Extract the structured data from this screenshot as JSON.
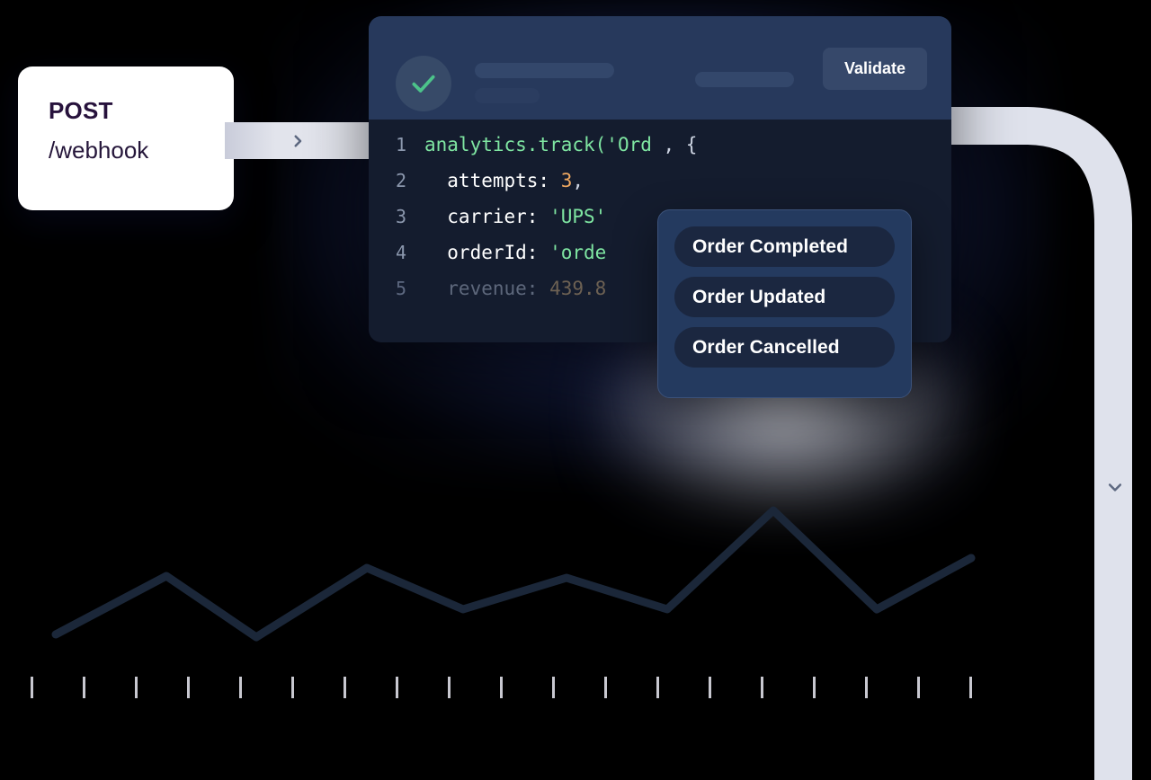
{
  "colors": {
    "background": "#000000",
    "card_white": "#ffffff",
    "editor_header": "#27395c",
    "editor_body": "#141c2e",
    "accent_green": "#4cc38a",
    "string_green": "#7fe6a2",
    "number_orange": "#f0a860",
    "dropdown_bg": "#243a5f",
    "dropdown_item_bg": "#1b2740",
    "connector_gray": "#e5e7ef",
    "chevron_gray": "#5d6880",
    "chart_line": "#1b2739",
    "tick_gray": "#c8c8d0"
  },
  "endpoint_card": {
    "method": "POST",
    "path": "/webhook"
  },
  "connector": {
    "forward_icon": "chevron-right-icon",
    "down_icon": "chevron-down-icon"
  },
  "editor": {
    "status_icon": "check-icon",
    "validate_label": "Validate",
    "skeleton_bars": 3,
    "lines": [
      {
        "number": "1",
        "dim": false,
        "tokens": [
          {
            "text": "analytics.track(",
            "type": "fn"
          },
          {
            "text": "'Ord",
            "type": "str"
          },
          {
            "text": " , {",
            "type": "punct"
          }
        ]
      },
      {
        "number": "2",
        "dim": false,
        "tokens": [
          {
            "text": "  attempts: ",
            "type": "key"
          },
          {
            "text": "3",
            "type": "num"
          },
          {
            "text": ",",
            "type": "punct"
          }
        ]
      },
      {
        "number": "3",
        "dim": false,
        "tokens": [
          {
            "text": "  carrier: ",
            "type": "key"
          },
          {
            "text": "'UPS'",
            "type": "str"
          }
        ]
      },
      {
        "number": "4",
        "dim": false,
        "tokens": [
          {
            "text": "  orderId: ",
            "type": "key"
          },
          {
            "text": "'orde",
            "type": "str"
          }
        ]
      },
      {
        "number": "5",
        "dim": true,
        "tokens": [
          {
            "text": "  revenue: ",
            "type": "dim"
          },
          {
            "text": "439.8",
            "type": "numdim"
          }
        ]
      }
    ]
  },
  "dropdown": {
    "items": [
      {
        "label": "Order Completed"
      },
      {
        "label": "Order Updated"
      },
      {
        "label": "Order Cancelled"
      }
    ]
  },
  "chart_data": {
    "type": "line",
    "title": "",
    "xlabel": "",
    "ylabel": "",
    "grid": false,
    "legend": null,
    "x": [
      62,
      120,
      178,
      236,
      294,
      352,
      410,
      468,
      526,
      584,
      642,
      700,
      758,
      816,
      874,
      932,
      990,
      1022,
      1080
    ],
    "points": [
      {
        "x": 62,
        "y": 706
      },
      {
        "x": 185,
        "y": 641
      },
      {
        "x": 285,
        "y": 709
      },
      {
        "x": 408,
        "y": 632
      },
      {
        "x": 515,
        "y": 678
      },
      {
        "x": 630,
        "y": 643
      },
      {
        "x": 742,
        "y": 678
      },
      {
        "x": 860,
        "y": 568
      },
      {
        "x": 975,
        "y": 678
      },
      {
        "x": 1080,
        "y": 621
      }
    ],
    "values": [
      706,
      641,
      709,
      632,
      678,
      643,
      678,
      568,
      678,
      621
    ],
    "ylim": [
      560,
      720
    ],
    "xlim": [
      0,
      1120
    ],
    "tick_count": 19,
    "tick_start_x": 34,
    "tick_spacing": 58,
    "tick_y": 753,
    "tick_height": 24
  }
}
